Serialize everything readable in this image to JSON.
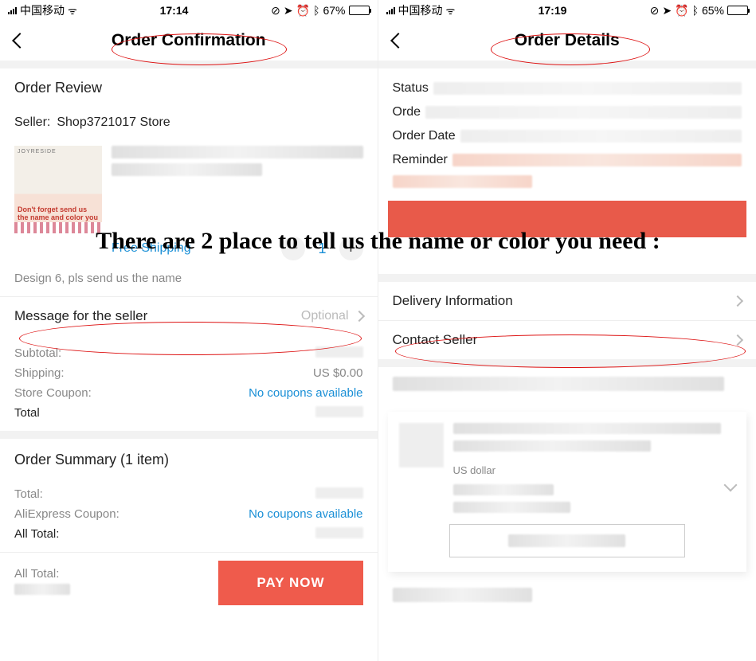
{
  "overlay": {
    "text": "There are 2 place to tell us the name or color you need :"
  },
  "left": {
    "status": {
      "carrier": "中国移动",
      "time": "17:14",
      "battery_pct": "67%"
    },
    "nav_title": "Order Confirmation",
    "order_review_title": "Order Review",
    "seller_label": "Seller:",
    "seller_name": "Shop3721017 Store",
    "product": {
      "thumb_brand": "JOYRESIDE",
      "thumb_note": "Don't forget send us the name and color you need!",
      "free_shipping": "Free Shipping",
      "quantity": "1",
      "variant_note": "Design 6, pls send us the name"
    },
    "message_seller": {
      "label": "Message for the seller",
      "hint": "Optional"
    },
    "totals": {
      "subtotal_label": "Subtotal:",
      "shipping_label": "Shipping:",
      "shipping_value": "US $0.00",
      "store_coupon_label": "Store Coupon:",
      "store_coupon_value": "No coupons available",
      "total_label": "Total"
    },
    "summary": {
      "title": "Order Summary (1 item)",
      "total_label": "Total:",
      "ali_coupon_label": "AliExpress Coupon:",
      "ali_coupon_value": "No coupons available",
      "all_total_label": "All Total:"
    },
    "paybar": {
      "all_total_label": "All Total:",
      "button": "PAY NOW"
    }
  },
  "right": {
    "status": {
      "carrier": "中国移动",
      "time": "17:19",
      "battery_pct": "65%"
    },
    "nav_title": "Order Details",
    "kv": {
      "status_label": "Status",
      "order_id_label": "Orde",
      "order_date_label": "Order Date",
      "reminder_label": "Reminder"
    },
    "rows": {
      "delivery": "Delivery Information",
      "contact": "Contact Seller"
    },
    "item": {
      "currency_note": "US dollar"
    }
  }
}
